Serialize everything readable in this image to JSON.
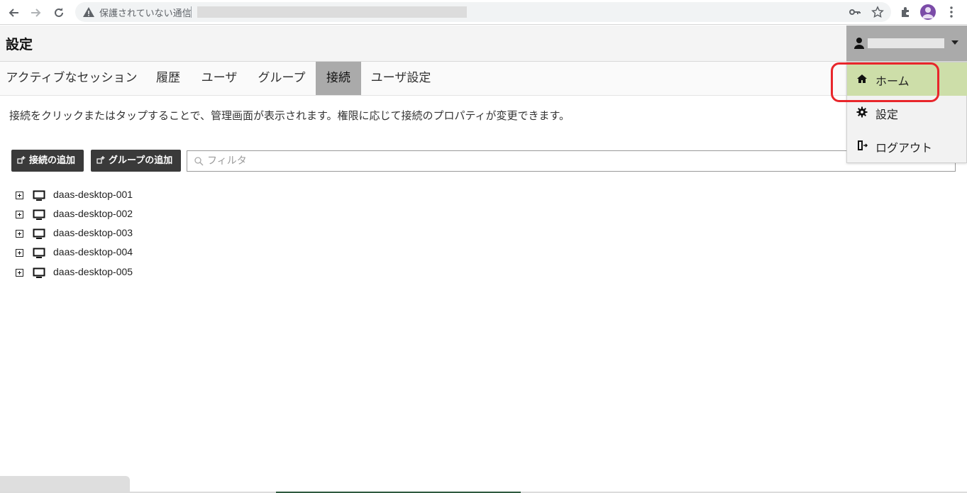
{
  "browser": {
    "security_label": "保護されていない通信"
  },
  "header": {
    "title": "設定"
  },
  "tabs": [
    {
      "label": "アクティブなセッション"
    },
    {
      "label": "履歴"
    },
    {
      "label": "ユーザ"
    },
    {
      "label": "グループ"
    },
    {
      "label": "接続",
      "active": true
    },
    {
      "label": "ユーザ設定"
    }
  ],
  "main": {
    "description": "接続をクリックまたはタップすることで、管理画面が表示されます。権限に応じて接続のプロパティが変更できます。",
    "add_connection_label": "接続の追加",
    "add_group_label": "グループの追加",
    "filter_placeholder": "フィルタ",
    "connections": [
      {
        "name": "daas-desktop-001"
      },
      {
        "name": "daas-desktop-002"
      },
      {
        "name": "daas-desktop-003"
      },
      {
        "name": "daas-desktop-004"
      },
      {
        "name": "daas-desktop-005"
      }
    ]
  },
  "user_menu": {
    "items": [
      {
        "label": "ホーム",
        "icon": "home-icon",
        "highlighted": true
      },
      {
        "label": "設定",
        "icon": "gear-icon"
      },
      {
        "label": "ログアウト",
        "icon": "logout-icon"
      }
    ]
  },
  "colors": {
    "active_tab": "#aaaaaa",
    "menu_highlight": "#cddea9",
    "annotation_red": "#e8262b",
    "button_dark": "#3a3a3a"
  }
}
